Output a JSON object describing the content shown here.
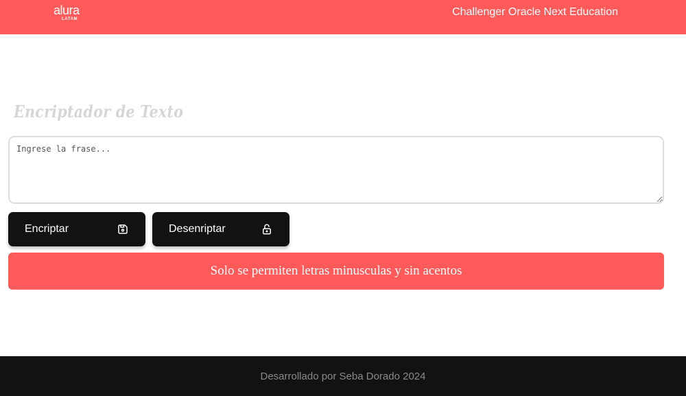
{
  "header": {
    "logo": {
      "main": "alura",
      "sub": "LATAM"
    },
    "title": "Challenger Oracle Next Education"
  },
  "main": {
    "title": "Encriptador de Texto",
    "input": {
      "placeholder": "Ingrese la frase...",
      "value": ""
    },
    "buttons": {
      "encrypt": {
        "label": "Encriptar",
        "icon": "save-icon"
      },
      "decrypt": {
        "label": "Desenriptar",
        "icon": "unlock-icon"
      }
    },
    "alert": "Solo se permiten letras minusculas y sin acentos"
  },
  "footer": {
    "text": "Desarrollado por Seba Dorado 2024"
  },
  "colors": {
    "accent": "#ff5a5a",
    "dark": "#121212",
    "title": "#d6d6d6"
  }
}
